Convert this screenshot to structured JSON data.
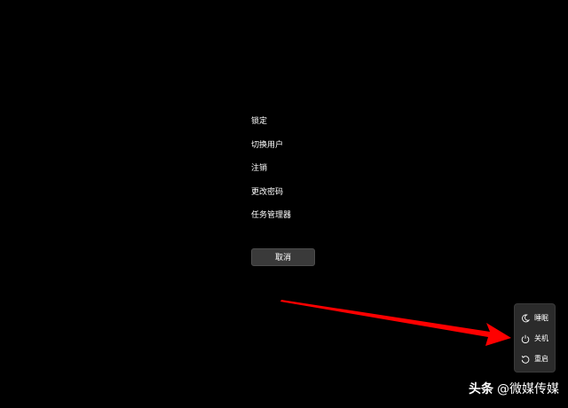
{
  "menu": {
    "items": [
      {
        "label": "锁定"
      },
      {
        "label": "切换用户"
      },
      {
        "label": "注销"
      },
      {
        "label": "更改密码"
      },
      {
        "label": "任务管理器"
      }
    ],
    "cancel_label": "取消"
  },
  "power_menu": {
    "items": [
      {
        "label": "睡眠",
        "icon": "moon-icon"
      },
      {
        "label": "关机",
        "icon": "power-icon"
      },
      {
        "label": "重启",
        "icon": "restart-icon"
      }
    ]
  },
  "annotation": {
    "color": "#ff0000"
  },
  "watermark": {
    "brand": "头条",
    "handle": "@微媒传媒"
  }
}
